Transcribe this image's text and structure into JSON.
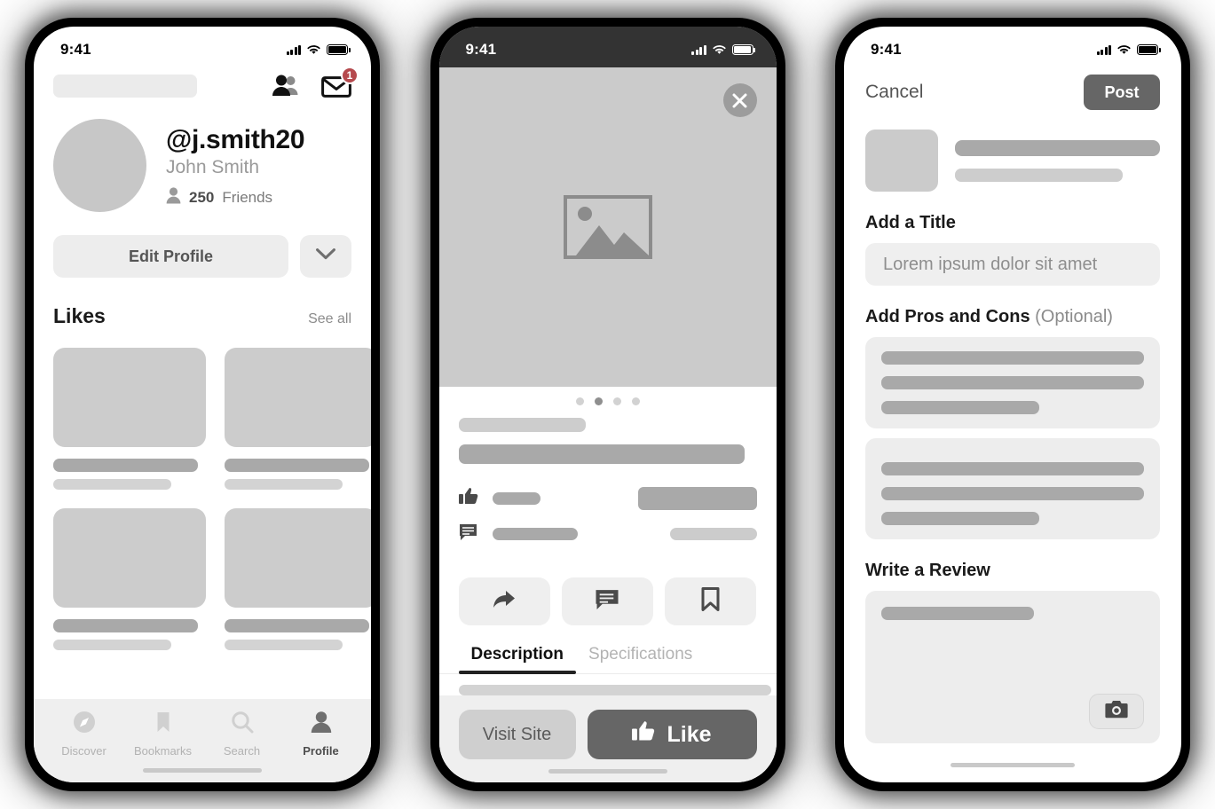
{
  "phones": [
    {
      "id": "profile-screen",
      "status_bar": {
        "time": "9:41",
        "theme": "light",
        "icons": [
          "signal-icon",
          "wifi-icon",
          "battery-icon"
        ]
      },
      "topbar": {
        "friends_icon": "people-icon",
        "mail_icon": "envelope-icon",
        "badge_count": "1"
      },
      "profile": {
        "handle": "@j.smith20",
        "full_name": "John Smith",
        "friends_count": "250",
        "friends_label": "Friends",
        "person_icon": "person-icon"
      },
      "actions": {
        "edit_label": "Edit Profile",
        "chevron_icon": "chevron-down-icon"
      },
      "likes": {
        "title": "Likes",
        "see_all": "See all",
        "rows": [
          [
            {
              "id": "like-1"
            },
            {
              "id": "like-2"
            },
            {
              "id": "like-3"
            }
          ],
          [
            {
              "id": "like-4"
            },
            {
              "id": "like-5"
            },
            {
              "id": "like-6"
            }
          ]
        ]
      },
      "tabbar": [
        {
          "label": "Discover",
          "icon": "compass-icon",
          "active": false
        },
        {
          "label": "Bookmarks",
          "icon": "bookmark-icon",
          "active": false
        },
        {
          "label": "Search",
          "icon": "search-icon",
          "active": false
        },
        {
          "label": "Profile",
          "icon": "person-icon",
          "active": true
        }
      ]
    },
    {
      "id": "product-detail-screen",
      "status_bar": {
        "time": "9:41",
        "theme": "dark",
        "icons": [
          "signal-icon",
          "wifi-icon",
          "battery-icon"
        ]
      },
      "hero": {
        "close_icon": "close-icon",
        "image_placeholder_icon": "image-placeholder-icon"
      },
      "carousel": {
        "dot_count": 4,
        "active_index": 1
      },
      "stats": {
        "like_icon": "thumbs-up-icon",
        "comment_icon": "comment-icon"
      },
      "action_buttons": [
        {
          "name": "share-button",
          "icon": "share-icon"
        },
        {
          "name": "comment-button",
          "icon": "comment-icon"
        },
        {
          "name": "bookmark-button",
          "icon": "bookmark-icon"
        }
      ],
      "tabs": [
        {
          "label": "Description",
          "active": true
        },
        {
          "label": "Specifications",
          "active": false
        }
      ],
      "footer": {
        "visit_label": "Visit Site",
        "like_label": "Like",
        "like_icon": "thumbs-up-icon"
      }
    },
    {
      "id": "compose-review-screen",
      "status_bar": {
        "time": "9:41",
        "theme": "light",
        "icons": [
          "signal-icon",
          "wifi-icon",
          "battery-icon"
        ]
      },
      "header": {
        "cancel_label": "Cancel",
        "post_label": "Post"
      },
      "title_field": {
        "label": "Add a Title",
        "placeholder": "Lorem ipsum dolor sit amet"
      },
      "pros_cons": {
        "label": "Add Pros and Cons",
        "optional": " (Optional)"
      },
      "review": {
        "label": "Write a Review",
        "camera_icon": "camera-icon"
      }
    }
  ],
  "colors": {
    "badge_red": "#b5494d",
    "accent_dark": "#666666",
    "skeleton_dark": "#a9a9a9",
    "skeleton_mid": "#cccccc",
    "skeleton_light": "#ebebeb",
    "status_bar_dark": "#333333"
  }
}
